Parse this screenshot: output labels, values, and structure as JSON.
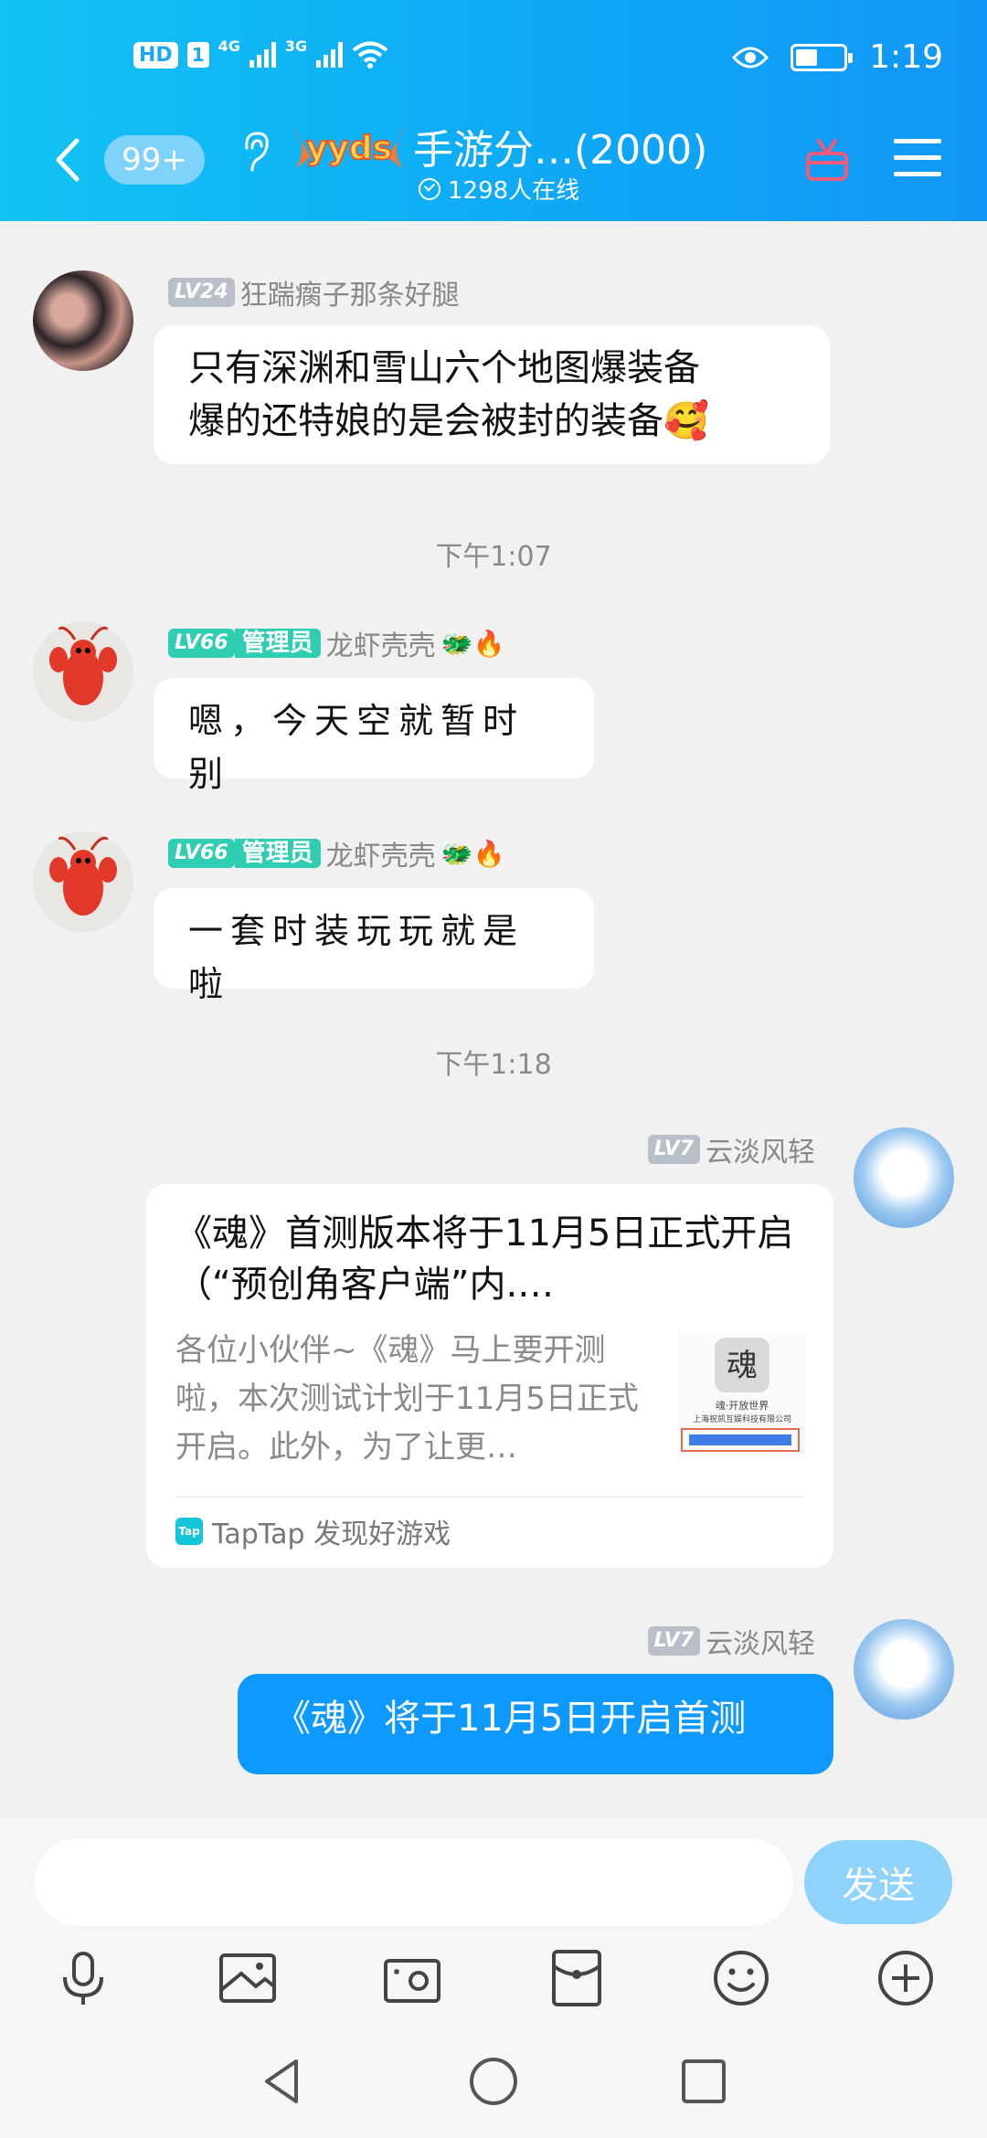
{
  "status_bar": {
    "hd": "HD",
    "sim": "1",
    "net1": "4G",
    "net2": "3G",
    "time": "1:19"
  },
  "header": {
    "unread": "99+",
    "logo_text": "yyds",
    "title": "手游分…(2000)",
    "online": "1298人在线"
  },
  "messages": [
    {
      "level": "LV24",
      "name": "狂踹瘸子那条好腿",
      "lines": [
        "只有深渊和雪山六个地图爆装备",
        "爆的还特娘的是会被封的装备🥰"
      ]
    },
    {
      "timestamp": "下午1:07"
    },
    {
      "level": "LV66",
      "badge": "管理员",
      "name": "龙虾壳壳",
      "emojis": "🐲🔥",
      "text": "嗯，今天空就暂时别"
    },
    {
      "level": "LV66",
      "badge": "管理员",
      "name": "龙虾壳壳",
      "emojis": "🐲🔥",
      "text": "一套时装玩玩就是啦"
    },
    {
      "timestamp": "下午1:18"
    },
    {
      "level": "LV7",
      "name": "云淡风轻",
      "card": {
        "title": "《魂》首测版本将于11月5日正式开启（“预创角客户端”内.…",
        "desc": "各位小伙伴~《魂》马上要开测啦，本次测试计划于11月5日正式开启。此外，为了让更…",
        "thumb_caption": "魂·开放世界",
        "thumb_company": "上海祝凯互娱科技有限公司",
        "source": "TapTap 发现好游戏",
        "source_icon_text": "Tap"
      }
    },
    {
      "level": "LV7",
      "name": "云淡风轻",
      "text": "《魂》将于11月5日开启首测"
    }
  ],
  "input": {
    "placeholder": "",
    "send_label": "发送"
  },
  "colors": {
    "header": "#12b4f5",
    "blue_bubble": "#0d99ff",
    "admin_green": "#2fcdb1"
  }
}
